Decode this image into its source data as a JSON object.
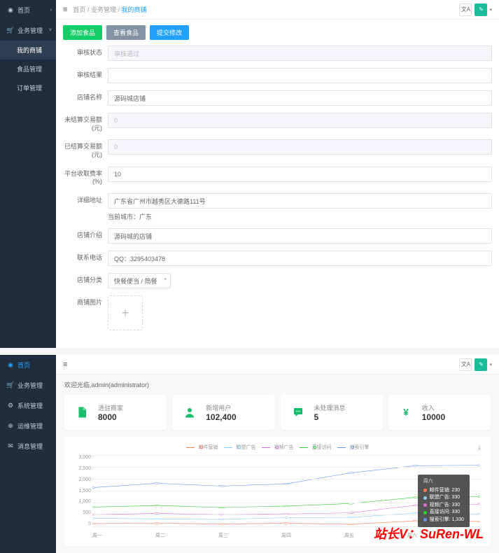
{
  "top": {
    "sidebar": [
      {
        "icon": "dash",
        "label": "首页",
        "active": false,
        "expand": false
      },
      {
        "icon": "cart",
        "label": "业务管理",
        "active": false,
        "expand": true,
        "children": [
          {
            "label": "我的商铺",
            "active": true
          },
          {
            "label": "食品管理",
            "active": false
          },
          {
            "label": "订单管理",
            "active": false
          }
        ]
      }
    ],
    "breadcrumb": {
      "a": "首页",
      "b": "业务管理",
      "c": "我的商铺"
    },
    "buttons": {
      "add": "添加食品",
      "view": "查看食品",
      "submit": "提交修改"
    },
    "form": {
      "l_status": "审核状态",
      "v_status": "审核通过",
      "l_result": "审核结果",
      "v_result": "",
      "l_name": "店铺名称",
      "v_name": "源码城店铺",
      "l_unset": "未结算交易额(元)",
      "v_unset": "0",
      "l_set": "已结算交易额(元)",
      "v_set": "0",
      "l_rate": "平台收取费率(%)",
      "v_rate": "10",
      "l_addr": "详细地址",
      "v_addr": "广东省广州市越秀区大德路111号",
      "note_addr": "当前城市：广东",
      "l_intro": "店铺介绍",
      "v_intro": "源码城的店铺",
      "l_tel": "联系电话",
      "v_tel": "QQ：3295403478",
      "l_cat": "店铺分类",
      "v_cat": "快餐便当 / 简餐",
      "l_img": "商铺图片"
    }
  },
  "bottom": {
    "sidebar": [
      {
        "icon": "dash",
        "label": "首页",
        "active": true
      },
      {
        "icon": "cart",
        "label": "业务管理"
      },
      {
        "icon": "gear",
        "label": "系统管理"
      },
      {
        "icon": "tool",
        "label": "运维管理"
      },
      {
        "icon": "msg",
        "label": "消息管理"
      }
    ],
    "welcome": "欢迎光临,admin(administrator)",
    "cards": [
      {
        "title": "进驻商家",
        "value": "8000",
        "icon": "doc"
      },
      {
        "title": "新增用户",
        "value": "102,400",
        "icon": "user"
      },
      {
        "title": "未处理消息",
        "value": "5",
        "icon": "chat"
      },
      {
        "title": "收入",
        "value": "10000",
        "icon": "yen"
      }
    ],
    "legend": [
      "邮件营销",
      "联盟广告",
      "视频广告",
      "直接访问",
      "搜索引擎"
    ],
    "tooltip": {
      "title": "周六",
      "rows": [
        {
          "c": "#ff7f50",
          "t": "邮件营销: 230"
        },
        {
          "c": "#87cefa",
          "t": "联盟广告: 330"
        },
        {
          "c": "#da70d6",
          "t": "视频广告: 330"
        },
        {
          "c": "#32cd32",
          "t": "直接访问: 330"
        },
        {
          "c": "#6495ed",
          "t": "搜索引擎: 1,330"
        }
      ]
    }
  },
  "chart_data": {
    "type": "line",
    "categories": [
      "周一",
      "周二",
      "周三",
      "周四",
      "周五",
      "周六",
      "周日"
    ],
    "series": [
      {
        "name": "邮件营销",
        "color": "#ff7f50",
        "values": [
          120,
          132,
          101,
          134,
          90,
          230,
          210
        ]
      },
      {
        "name": "联盟广告",
        "color": "#87cefa",
        "values": [
          220,
          182,
          191,
          234,
          290,
          330,
          310
        ]
      },
      {
        "name": "视频广告",
        "color": "#da70d6",
        "values": [
          150,
          232,
          201,
          154,
          190,
          330,
          410
        ]
      },
      {
        "name": "直接访问",
        "color": "#32cd32",
        "values": [
          320,
          332,
          301,
          334,
          390,
          330,
          320
        ]
      },
      {
        "name": "搜索引擎",
        "color": "#6495ed",
        "values": [
          820,
          932,
          901,
          934,
          1290,
          1330,
          1320
        ]
      }
    ],
    "ylabel": "",
    "xlabel": "",
    "ylim": [
      0,
      3000
    ],
    "yticks": [
      0,
      500,
      1000,
      1500,
      2000,
      2500,
      3000
    ],
    "stacked_max": [
      1630,
      1810,
      1695,
      1790,
      2250,
      2550,
      2570
    ]
  },
  "watermark": "站长V：SuRen-WL"
}
